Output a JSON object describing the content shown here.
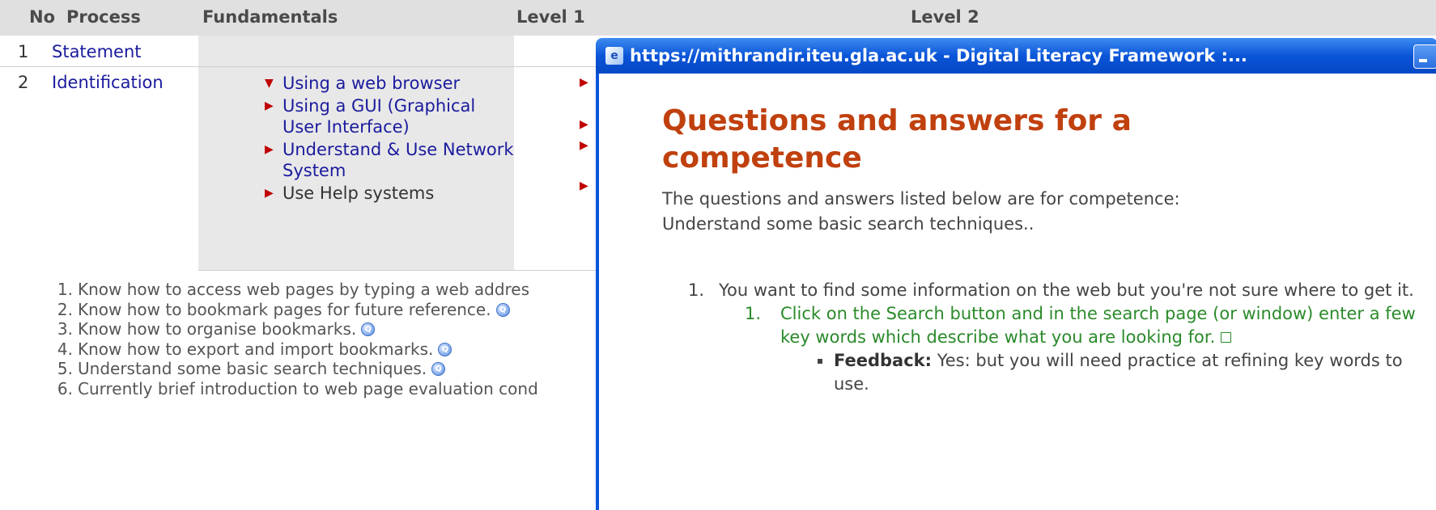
{
  "table": {
    "headers": [
      "No",
      "Process",
      "Fundamentals",
      "Level 1",
      "Level 2"
    ],
    "rows": [
      {
        "no": "1",
        "process": "Statement"
      },
      {
        "no": "2",
        "process": "Identification"
      }
    ],
    "fundamentals": [
      {
        "label": "Using a web browser",
        "expanded": true
      },
      {
        "label": "Using a GUI (Graphical User Interface)",
        "expanded": false
      },
      {
        "label": "Understand & Use Network System",
        "expanded": false
      },
      {
        "label": "Use Help systems",
        "expanded": false
      }
    ]
  },
  "competences": [
    {
      "num": "1.",
      "text": "Know how to access web pages by typing a web addres"
    },
    {
      "num": "2.",
      "text": "Know how to bookmark pages for future reference."
    },
    {
      "num": "3.",
      "text": "Know how to organise bookmarks."
    },
    {
      "num": "4.",
      "text": "Know how to export and import bookmarks."
    },
    {
      "num": "5.",
      "text": "Understand some basic search techniques."
    },
    {
      "num": "6.",
      "text": "Currently brief introduction to web page evaluation cond"
    }
  ],
  "popup": {
    "title": "https://mithrandir.iteu.gla.ac.uk - Digital Literacy Framework :...",
    "heading": "Questions and answers for a competence",
    "intro": "The questions and answers listed below are for competence: Understand some basic search techniques..",
    "question": {
      "num": "1.",
      "text": "You want to find some information on the web but you're not sure where to get it."
    },
    "answer": {
      "num": "1.",
      "text": "Click on the Search button and in the search page (or window) enter a few key words which describe what you are looking for."
    },
    "feedback": {
      "label": "Feedback:",
      "text": "Yes: but you will need practice at refining key words to use."
    }
  },
  "icons": {
    "expanded-arrow": "▼",
    "collapsed-arrow": "▶",
    "question-icon": "Q"
  },
  "colors": {
    "link": "#1b1b9e",
    "arrow": "#c00000",
    "heading": "#c0400e",
    "answer": "#2a8a2a",
    "titlebar": "#0a55d8"
  }
}
